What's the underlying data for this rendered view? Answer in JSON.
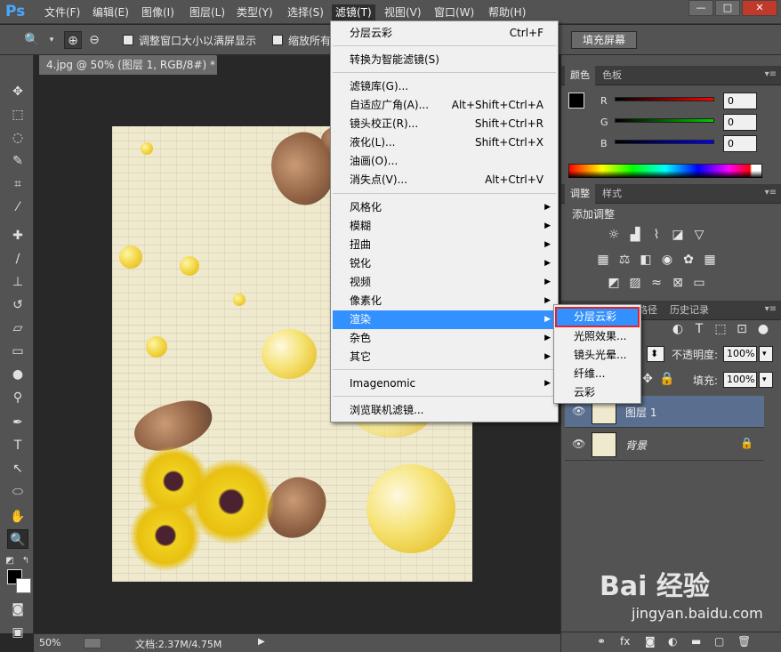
{
  "app": {
    "logo": "Ps",
    "menu": [
      "文件(F)",
      "编辑(E)",
      "图像(I)",
      "图层(L)",
      "类型(Y)",
      "选择(S)",
      "滤镜(T)",
      "视图(V)",
      "窗口(W)",
      "帮助(H)"
    ],
    "window_buttons": [
      "—",
      "□",
      "✕"
    ]
  },
  "options": {
    "resize_window_label": "调整窗口大小以满屏显示",
    "zoom_all_label": "缩放所有",
    "fill_screen_label": "填充屏幕"
  },
  "document": {
    "tab_title": "4.jpg @ 50% (图层 1, RGB/8#) *",
    "tab_close": "×",
    "zoom": "50%",
    "size": "文档:2.37M/4.75M"
  },
  "color_panel": {
    "tabs": [
      "颜色",
      "色板"
    ],
    "channels": [
      {
        "label": "R",
        "value": "0",
        "color": "#ff0000"
      },
      {
        "label": "G",
        "value": "0",
        "color": "#00cc00"
      },
      {
        "label": "B",
        "value": "0",
        "color": "#0000ff"
      }
    ]
  },
  "adjust_panel": {
    "tabs": [
      "调整",
      "样式"
    ],
    "heading": "添加调整"
  },
  "layers_panel": {
    "tabs": [
      "路径",
      "历史记录"
    ],
    "opacity_label": "不透明度:",
    "opacity_value": "100%",
    "fill_label": "填充:",
    "fill_value": "100%",
    "layers": [
      {
        "name": "图层 1",
        "selected": true,
        "locked": false
      },
      {
        "name": "背景",
        "selected": false,
        "locked": true
      }
    ]
  },
  "filter_menu": {
    "items": [
      {
        "label": "分层云彩",
        "shortcut": "Ctrl+F"
      },
      {
        "label": "转换为智能滤镜(S)"
      },
      {
        "label": "滤镜库(G)..."
      },
      {
        "label": "自适应广角(A)...",
        "shortcut": "Alt+Shift+Ctrl+A"
      },
      {
        "label": "镜头校正(R)...",
        "shortcut": "Shift+Ctrl+R"
      },
      {
        "label": "液化(L)...",
        "shortcut": "Shift+Ctrl+X"
      },
      {
        "label": "油画(O)..."
      },
      {
        "label": "消失点(V)...",
        "shortcut": "Alt+Ctrl+V"
      },
      {
        "label": "风格化"
      },
      {
        "label": "模糊"
      },
      {
        "label": "扭曲"
      },
      {
        "label": "锐化"
      },
      {
        "label": "视频"
      },
      {
        "label": "像素化"
      },
      {
        "label": "渲染"
      },
      {
        "label": "杂色"
      },
      {
        "label": "其它"
      },
      {
        "label": "Imagenomic"
      },
      {
        "label": "浏览联机滤镜..."
      }
    ]
  },
  "render_submenu": {
    "items": [
      "分层云彩",
      "光照效果...",
      "镜头光晕...",
      "纤维...",
      "云彩"
    ]
  },
  "watermark": {
    "logo": "Bai 经验",
    "url": "jingyan.baidu.com"
  }
}
